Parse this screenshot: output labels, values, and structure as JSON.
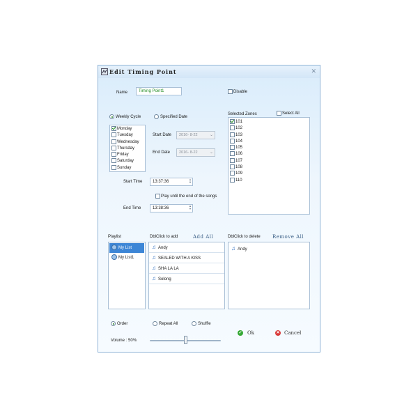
{
  "window": {
    "title": "Edit Timing Point"
  },
  "name": {
    "label": "Name",
    "value": "Timing Point1"
  },
  "disable": {
    "label": "Disable",
    "checked": false
  },
  "cycle": {
    "weekly_label": "Weekly Cycle",
    "weekly_selected": true,
    "specified_label": "Specified Date",
    "specified_selected": false
  },
  "days": [
    {
      "label": "Monday",
      "checked": true
    },
    {
      "label": "Tuesday",
      "checked": false
    },
    {
      "label": "Wednesday",
      "checked": false
    },
    {
      "label": "Thursday",
      "checked": false
    },
    {
      "label": "Friday",
      "checked": false
    },
    {
      "label": "Saturday",
      "checked": false
    },
    {
      "label": "Sunday",
      "checked": false
    }
  ],
  "dates": {
    "start_label": "Start Date",
    "start_value": "2016- 8-22",
    "end_label": "End Date",
    "end_value": "2016- 8-22"
  },
  "zones": {
    "label": "Selected Zones",
    "select_all_label": "Select All",
    "items": [
      {
        "label": "101",
        "checked": true
      },
      {
        "label": "102",
        "checked": false
      },
      {
        "label": "103",
        "checked": false
      },
      {
        "label": "104",
        "checked": false
      },
      {
        "label": "105",
        "checked": false
      },
      {
        "label": "106",
        "checked": false
      },
      {
        "label": "107",
        "checked": false
      },
      {
        "label": "108",
        "checked": false
      },
      {
        "label": "109",
        "checked": false
      },
      {
        "label": "110",
        "checked": false
      }
    ]
  },
  "times": {
    "start_label": "Start Time",
    "start_value": "13:37:36",
    "play_until_label": "Play until the end of the songs",
    "end_label": "End Time",
    "end_value": "13:38:36"
  },
  "playlist": {
    "label": "Playlist",
    "items": [
      {
        "label": "My List",
        "selected": true
      },
      {
        "label": "My List1",
        "selected": false
      }
    ]
  },
  "add_panel": {
    "label": "DblClick to add",
    "add_all_label": "Add All",
    "songs": [
      "Andy",
      "SEALED WITH A KISS",
      "SHA LA LA",
      "Solong"
    ]
  },
  "delete_panel": {
    "label": "DblClick to delete",
    "remove_all_label": "Remove All",
    "songs": [
      "Andy"
    ]
  },
  "playmode": {
    "order_label": "Order",
    "repeat_all_label": "Repeat All",
    "shuffle_label": "Shuffle",
    "selected": "Order"
  },
  "volume": {
    "label": "Volume : 50%",
    "value": 50
  },
  "buttons": {
    "ok_label": "Ok",
    "cancel_label": "Cancel"
  },
  "colors": {
    "ok_icon": "#35a835",
    "cancel_icon": "#d93a3a",
    "selection": "#3d86d6",
    "name_text": "#1f8a1f"
  }
}
